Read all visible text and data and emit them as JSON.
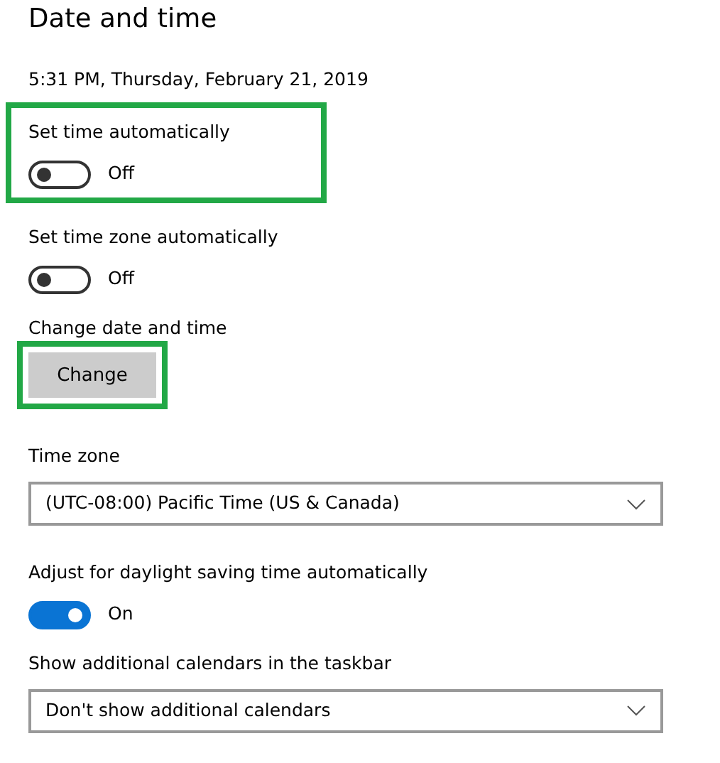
{
  "title": "Date and time",
  "current_time": "5:31 PM, Thursday, February 21, 2019",
  "settings": [
    {
      "kind": "toggle",
      "label": "Set time automatically",
      "on": false,
      "state_text": "Off",
      "highlighted": true
    },
    {
      "kind": "toggle",
      "label": "Set time zone automatically",
      "on": false,
      "state_text": "Off",
      "highlighted": false
    },
    {
      "kind": "button",
      "label": "Change date and time",
      "button": "Change",
      "highlighted": true
    },
    {
      "kind": "dropdown",
      "label": "Time zone",
      "value": "(UTC-08:00) Pacific Time (US & Canada)",
      "highlighted": false
    },
    {
      "kind": "toggle",
      "label": "Adjust for daylight saving time automatically",
      "on": true,
      "state_text": "On",
      "highlighted": false
    },
    {
      "kind": "dropdown",
      "label": "Show additional calendars in the taskbar",
      "value": "Don't show additional calendars",
      "highlighted": false
    }
  ]
}
